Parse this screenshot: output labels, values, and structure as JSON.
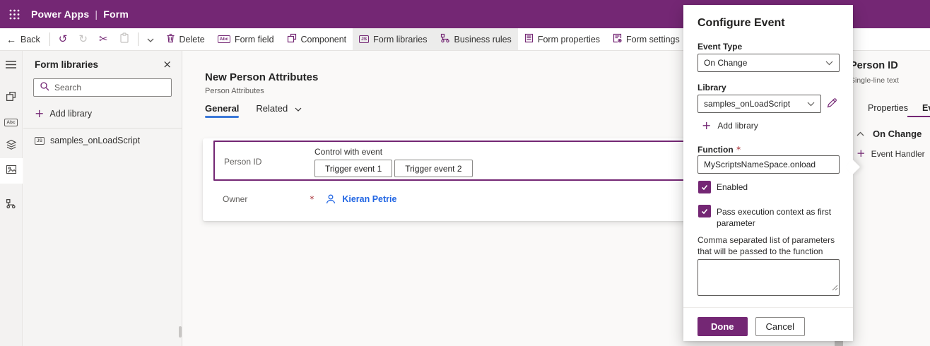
{
  "app": {
    "product": "Power Apps",
    "separator": "|",
    "page": "Form"
  },
  "toolbar": {
    "back": "Back",
    "delete": "Delete",
    "form_field": "Form field",
    "component": "Component",
    "form_libraries": "Form libraries",
    "business_rules": "Business rules",
    "form_properties": "Form properties",
    "form_settings": "Form settings",
    "more": "···"
  },
  "icons": {
    "undo": "↺",
    "redo": "↻",
    "cut": "✂",
    "back_arrow": "←",
    "close": "×",
    "plus": "+",
    "form_field_badge": "Abc",
    "js_badge": "JS"
  },
  "library_panel": {
    "title": "Form libraries",
    "search_placeholder": "Search",
    "add_library": "Add library",
    "library_item": "samples_onLoadScript"
  },
  "canvas": {
    "form_title": "New Person Attributes",
    "form_subtitle": "Person Attributes",
    "tabs": {
      "general": "General",
      "related": "Related"
    },
    "person_id_label": "Person ID",
    "control_label": "Control with event",
    "trigger1": "Trigger event 1",
    "trigger2": "Trigger event 2",
    "owner_label": "Owner",
    "required_mark": "*",
    "owner_value": "Kieran Petrie"
  },
  "dialog": {
    "title": "Configure Event",
    "event_type_label": "Event Type",
    "event_type_value": "On Change",
    "library_label": "Library",
    "library_value": "samples_onLoadScript",
    "add_library": "Add library",
    "function_label": "Function",
    "required_mark": "*",
    "function_value": "MyScriptsNameSpace.onload",
    "enabled_label": "Enabled",
    "pass_context_label": "Pass execution context as first parameter",
    "params_label": "Comma separated list of parameters that will be passed to the function",
    "done": "Done",
    "cancel": "Cancel"
  },
  "right_panel": {
    "field_title": "Person ID",
    "field_subtitle": "Single-line text",
    "tab_properties": "Properties",
    "tab_events": "Events",
    "on_change": "On Change",
    "event_handler": "Event Handler"
  },
  "colors": {
    "brand_purple": "#742774",
    "link_blue": "#2266e3",
    "tab_underline_blue": "#3b78d8",
    "required_red": "#a4262c"
  }
}
